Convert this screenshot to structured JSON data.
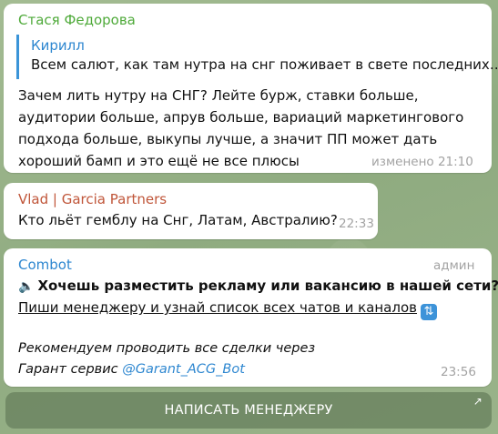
{
  "messages": [
    {
      "sender": "Стася Федорова",
      "sender_color": "#4faa3a",
      "reply": {
        "name": "Кирилл",
        "text": "Всем салют, как там нутра на снг поживает в свете последних…"
      },
      "lines": [
        "Зачем лить нутру на СНГ? Лейте бурж, ставки больше,",
        "аудитории больше, апрув больше, вариаций маркетингового",
        "подхода больше, выкупы лучше, а значит ПП может дать",
        "хороший бамп и это ещё не все плюсы"
      ],
      "time": "изменено 21:10"
    },
    {
      "sender": "Vlad | Garcia Partners",
      "sender_color": "#c0563a",
      "lines": [
        "Кто льёт гемблу на Снг, Латам, Австралию?"
      ],
      "time": "22:33"
    },
    {
      "sender": "Combot",
      "sender_color": "#2e87d0",
      "role": "админ",
      "headline": "Хочешь разместить рекламу или вакансию в нашей сети?",
      "headline_icon": "speaker-icon",
      "link_line": "Пиши менеджеру и узнай список всех чатов и каналов",
      "link_icon": "arrows-icon",
      "italic_1": "Рекомендуем проводить все сделки через",
      "italic_2_prefix": "Гарант сервис ",
      "italic_2_link": "@Garant_ACG_Bot",
      "time": "23:56"
    }
  ],
  "cta": {
    "label": "НАПИСАТЬ МЕНЕДЖЕРУ",
    "icon": "external-arrow-icon"
  }
}
